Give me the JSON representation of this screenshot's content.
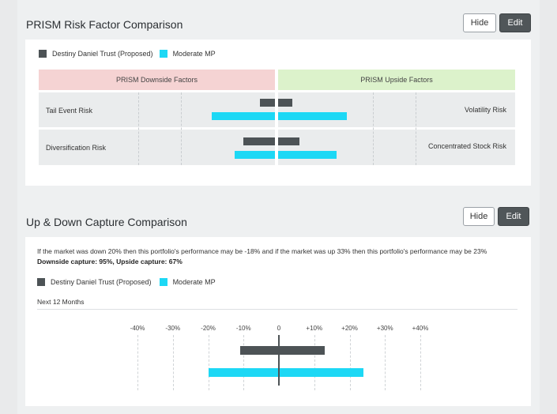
{
  "prism": {
    "title": "PRISM Risk Factor Comparison",
    "hide_label": "Hide",
    "edit_label": "Edit",
    "legend": [
      "Destiny Daniel Trust (Proposed)",
      "Moderate MP"
    ],
    "downside_header": "PRISM Downside Factors",
    "upside_header": "PRISM Upside Factors",
    "rows": [
      {
        "left": "Tail Event Risk",
        "right": "Volatility Risk"
      },
      {
        "left": "Diversification Risk",
        "right": "Concentrated Stock Risk"
      }
    ]
  },
  "capture": {
    "title": "Up & Down Capture Comparison",
    "hide_label": "Hide",
    "edit_label": "Edit",
    "description": "If the market was down 20% then this portfolio's performance may be -18% and if the market was up 33% then this portfolio's performance may be 23%",
    "summary": "Downside capture: 95%, Upside capture: 67%",
    "legend": [
      "Destiny Daniel Trust (Proposed)",
      "Moderate MP"
    ],
    "period": "Next 12 Months",
    "ticks": [
      "-40%",
      "-30%",
      "-20%",
      "-10%",
      "0",
      "+10%",
      "+20%",
      "+30%",
      "+40%"
    ]
  },
  "chart_data": {
    "type": "bar",
    "categories": [
      "Destiny Daniel Trust (Proposed)",
      "Moderate MP"
    ],
    "series": [
      {
        "name": "Destiny Daniel Trust (Proposed)",
        "values": [
          -11,
          13
        ]
      },
      {
        "name": "Moderate MP",
        "values": [
          -20,
          24
        ]
      }
    ],
    "xlim": [
      -40,
      40
    ],
    "colors": {
      "dark": "#4d5356",
      "cyan": "#1dd8f5"
    }
  }
}
